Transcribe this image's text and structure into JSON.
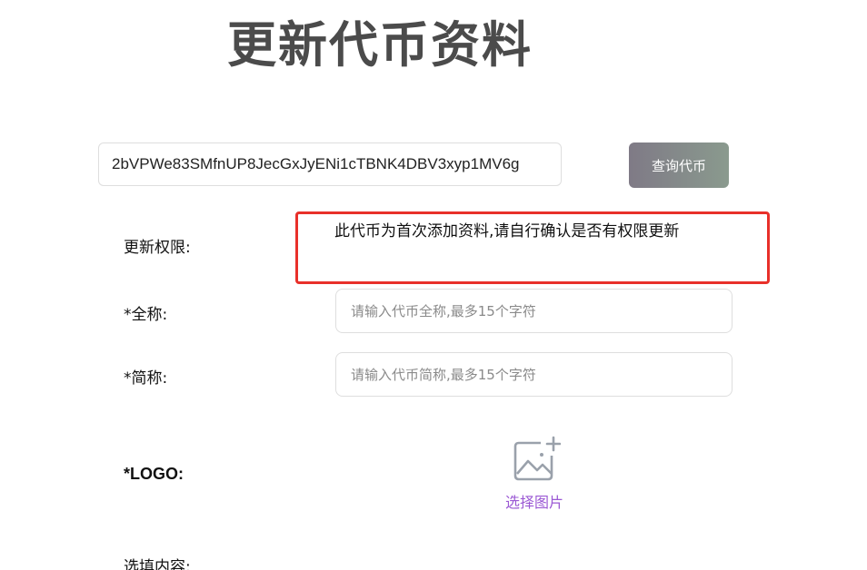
{
  "page": {
    "title": "更新代币资料"
  },
  "search": {
    "address_value": "2bVPWe83SMfnUP8JecGxJyENi1cTBNK4DBV3xyp1MV6g",
    "query_button_label": "查询代币"
  },
  "form": {
    "permission": {
      "label": "更新权限:",
      "message": "此代币为首次添加资料,请自行确认是否有权限更新"
    },
    "full_name": {
      "label": "*全称:",
      "placeholder": "请输入代币全称,最多15个字符"
    },
    "short_name": {
      "label": "*简称:",
      "placeholder": "请输入代币简称,最多15个字符"
    },
    "logo": {
      "label": "*LOGO:",
      "upload_label": "选择图片",
      "icon": "image-add-icon"
    },
    "optional_section": {
      "label": "选填内容:"
    }
  },
  "colors": {
    "title": "#4b4b4b",
    "highlight_border": "#e8302a",
    "upload_text": "#9b59d4",
    "button_gradient_start": "#7f7a86",
    "button_gradient_end": "#8a9a8e"
  }
}
